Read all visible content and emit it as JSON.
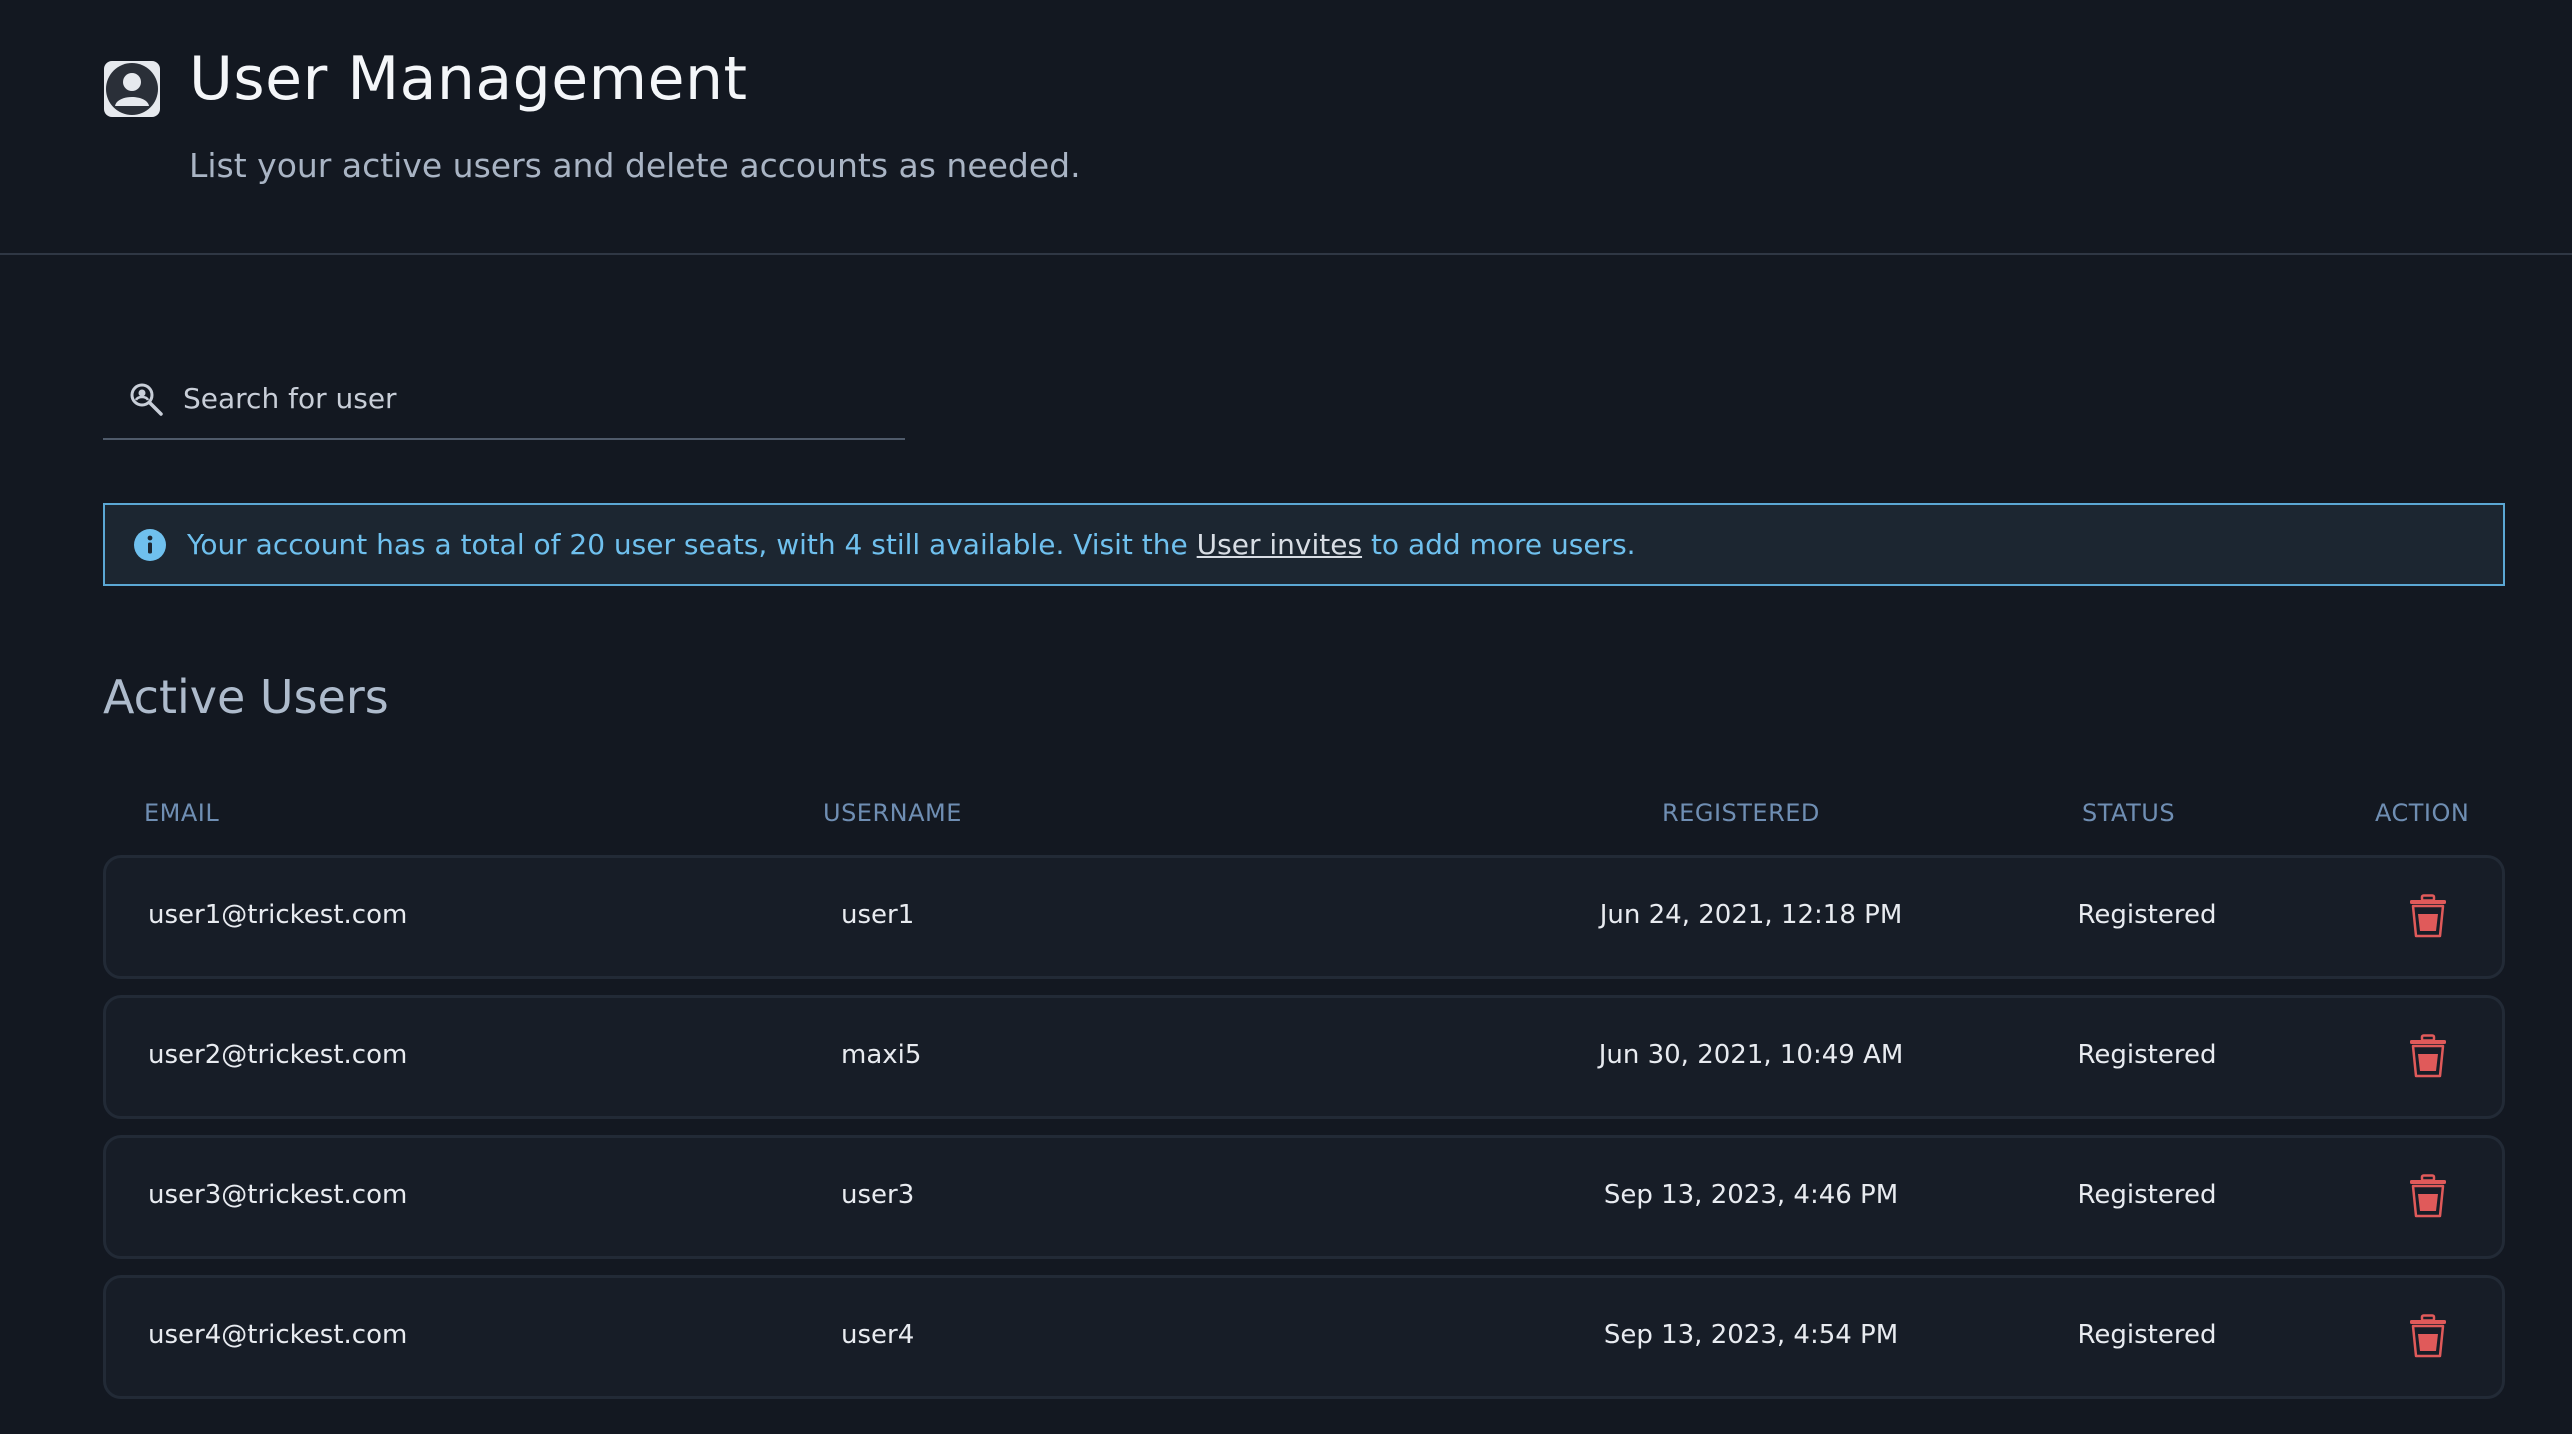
{
  "header": {
    "title": "User Management",
    "subtitle": "List your active users and delete accounts as needed."
  },
  "search": {
    "placeholder": "Search for user",
    "value": ""
  },
  "banner": {
    "text_before": "Your account has a total of 20 user seats, with 4 still available. Visit the ",
    "link": "User invites",
    "text_after": " to add more users."
  },
  "section": {
    "title": "Active Users"
  },
  "table": {
    "columns": {
      "email": "EMAIL",
      "username": "USERNAME",
      "registered": "REGISTERED",
      "status": "STATUS",
      "action": "ACTION"
    },
    "rows": [
      {
        "email": "user1@trickest.com",
        "username": "user1",
        "registered": "Jun 24, 2021, 12:18 PM",
        "status": "Registered"
      },
      {
        "email": "user2@trickest.com",
        "username": "maxi5",
        "registered": "Jun 30, 2021, 10:49 AM",
        "status": "Registered"
      },
      {
        "email": "user3@trickest.com",
        "username": "user3",
        "registered": "Sep 13, 2023, 4:46 PM",
        "status": "Registered"
      },
      {
        "email": "user4@trickest.com",
        "username": "user4",
        "registered": "Sep 13, 2023, 4:54 PM",
        "status": "Registered"
      }
    ]
  },
  "icons": {
    "header": "user-avatar-icon",
    "search": "search-icon",
    "info": "info-icon",
    "delete": "trash-icon"
  },
  "colors": {
    "background": "#131821",
    "accent_info": "#6fc0ee",
    "danger": "#e05a5a",
    "header_text": "#6f8eb3"
  }
}
